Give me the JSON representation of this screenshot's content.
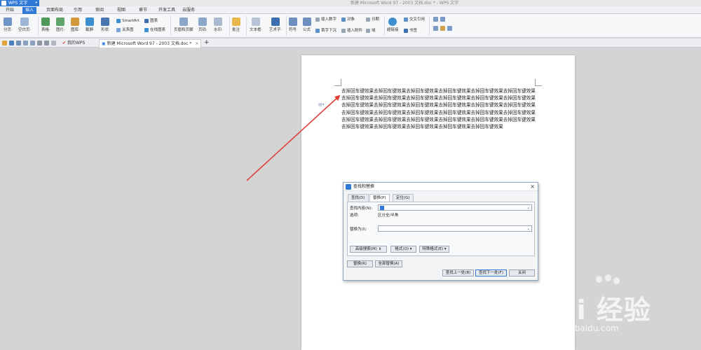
{
  "titlebar": {
    "app_label": "WPS 文字",
    "title": "新建 Microsoft Word 97 - 2003 文档.doc * - WPS 文字"
  },
  "ribbon_tabs": [
    "开始",
    "插入",
    "页面布局",
    "引用",
    "审阅",
    "视图",
    "章节",
    "开发工具",
    "云服务"
  ],
  "active_tab_index": 1,
  "ribbon": {
    "page_break": "分页·",
    "blank_page": "空白页·",
    "table": "表格·",
    "picture": "图片·",
    "gallery": "图库·",
    "screenshot": "截屏·",
    "shape": "形状·",
    "smartart": "SmartArt",
    "chart": "图表",
    "relation": "关系图",
    "online_chart": "在线图表",
    "header_footer": "页眉和页脚",
    "page_number": "页码·",
    "watermark": "水印·",
    "comment": "批注",
    "textbox": "文本框·",
    "wordart": "艺术字·",
    "symbol": "符号·",
    "formula": "公式",
    "insert_number": "插入数字",
    "object": "对象·",
    "date": "日期",
    "drop_cap": "首字下沉",
    "attachment": "插入附件",
    "field": "域",
    "hyperlink": "超链接",
    "cross_ref": "交叉引用",
    "bookmark": "书签"
  },
  "doc_tabs": {
    "my_wps": "我的WPS",
    "document": "新建 Microsoft Word 97 - 2003 文档.doc *",
    "close": "×",
    "add": "+"
  },
  "document": {
    "body": "去掉回车键效果去掉回车键效果去掉回车键效果去掉回车键效果去掉回车键效果去掉回车键效果去掉回车键效果去掉回车键效果去掉回车键效果去掉回车键效果去掉回车键效果去掉回车键效果去掉回车键效果去掉回车键效果去掉回车键效果去掉回车键效果去掉回车键效果去掉回车键效果去掉回车键效果去掉回车键效果去掉回车键效果去掉回车键效果去掉回车键效果去掉回车键效果去掉回车键效果去掉回车键效果去掉回车键效果去掉回车键效果去掉回车键效果去掉回车键效果去掉回车键效果去掉回车键效果去掉回车键效果去掉回车键效果去掉回车键效果"
  },
  "dialog": {
    "title": "查找和替换",
    "close": "×",
    "tabs": [
      "查找(D)",
      "替换(P)",
      "定位(G)"
    ],
    "active_tab_index": 1,
    "find_label": "查找内容(N):",
    "options_label": "选项:",
    "options_value": "区分全/半角",
    "replace_label": "替换为(I):",
    "adv_search": "高级搜索(M) ⇟",
    "format": "格式(O) ▾",
    "special": "特殊格式(E) ▾",
    "replace_btn": "替换(R)",
    "replace_all_btn": "全部替换(A)",
    "find_prev": "查找上一处(B)",
    "find_next": "查找下一处(F)",
    "close_btn": "关闭"
  },
  "watermark": {
    "brand": "Bai 经验",
    "url": "jingyan.baidu.com"
  },
  "colors": {
    "accent": "#2f7ad6",
    "arrow": "#e0403a"
  }
}
